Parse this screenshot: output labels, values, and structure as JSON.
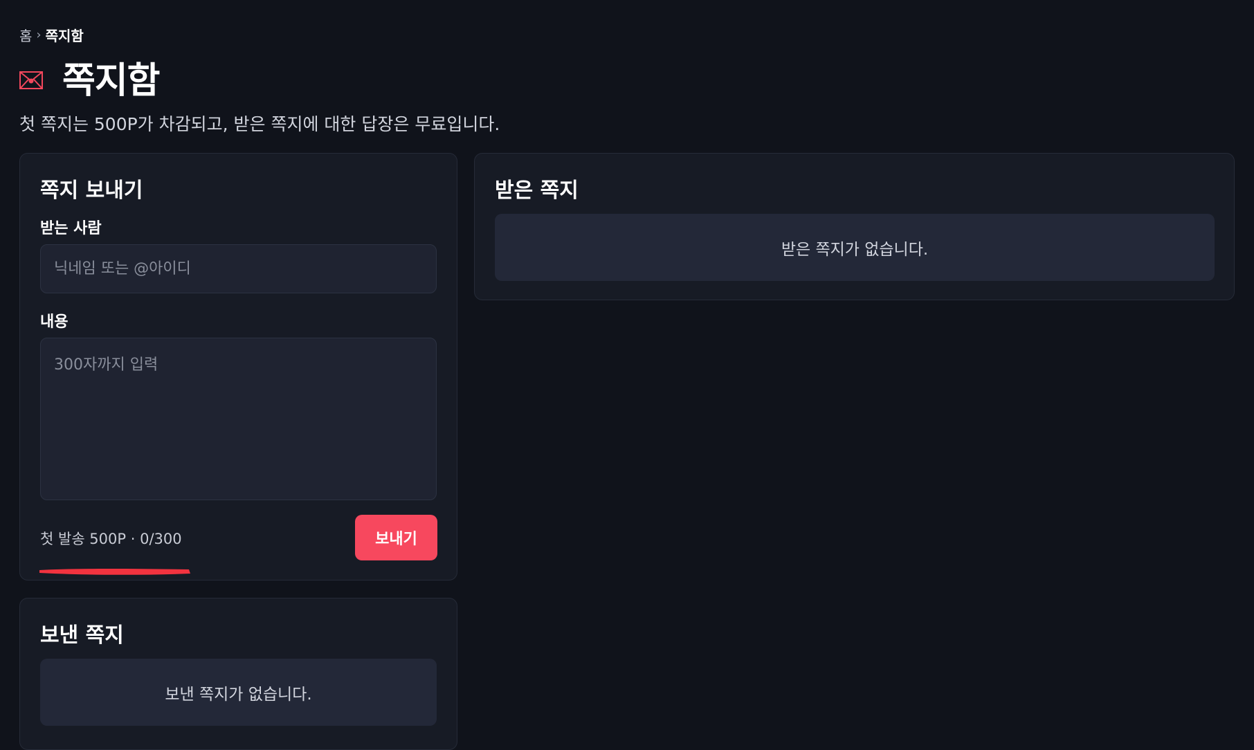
{
  "breadcrumb": {
    "home": "홈",
    "separator": "›",
    "current": "쪽지함"
  },
  "header": {
    "icon": "envelope-icon",
    "title": "쪽지함",
    "subtitle": "첫 쪽지는 500P가 차감되고, 받은 쪽지에 대한 답장은 무료입니다."
  },
  "compose": {
    "title": "쪽지 보내기",
    "recipient_label": "받는 사람",
    "recipient_value": "",
    "recipient_placeholder": "닉네임 또는 @아이디",
    "content_label": "내용",
    "content_value": "",
    "content_placeholder": "300자까지 입력",
    "counter_text": "첫 발송 500P · 0/300",
    "send_label": "보내기"
  },
  "inbox": {
    "title": "받은 쪽지",
    "empty_text": "받은 쪽지가 없습니다."
  },
  "sent": {
    "title": "보낸 쪽지",
    "empty_text": "보낸 쪽지가 없습니다."
  },
  "colors": {
    "background": "#10131b",
    "card": "#171b25",
    "accent": "#f7485e",
    "annotation": "#f2333f"
  }
}
